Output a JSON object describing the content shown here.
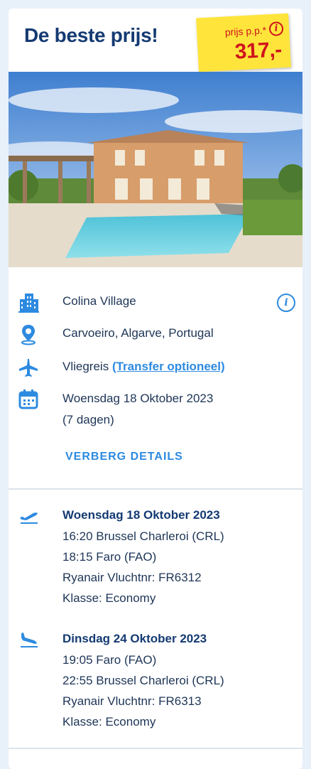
{
  "header": {
    "title": "De beste prijs!",
    "price_label": "prijs p.p.*",
    "price_value": "317,-"
  },
  "details": {
    "hotel": "Colina Village",
    "location": "Carvoeiro, Algarve, Portugal",
    "travel_type": "Vliegreis",
    "transfer_link": "(Transfer optioneel)",
    "date": "Woensdag 18 Oktober 2023",
    "duration": "(7 dagen)",
    "hide_details": "VERBERG DETAILS"
  },
  "flights": [
    {
      "date": "Woensdag 18 Oktober 2023",
      "depart": "16:20 Brussel Charleroi (CRL)",
      "arrive": "18:15 Faro (FAO)",
      "carrier": "Ryanair Vluchtnr: FR6312",
      "class": "Klasse: Economy"
    },
    {
      "date": "Dinsdag 24 Oktober 2023",
      "depart": "19:05 Faro (FAO)",
      "arrive": "22:55 Brussel Charleroi (CRL)",
      "carrier": "Ryanair Vluchtnr: FR6313",
      "class": "Klasse: Economy"
    }
  ],
  "icons": {
    "hotel": "building-icon",
    "location": "map-pin-icon",
    "travel": "airplane-icon",
    "date": "calendar-icon",
    "info": "info-icon",
    "departure": "takeoff-icon",
    "return": "landing-icon"
  },
  "colors": {
    "accent": "#2d8ae0",
    "title": "#143a72",
    "price_tag": "#ffe53b",
    "price_text": "#d0131c"
  }
}
